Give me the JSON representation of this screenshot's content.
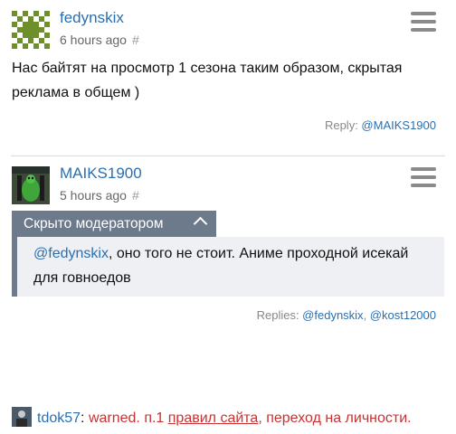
{
  "comments": [
    {
      "author": "fedynskix",
      "time": "6 hours ago",
      "hash": "#",
      "text": "Нас байтят на просмотр 1 сезона таким образом, скрытая реклама в общем )",
      "reply_prefix": "Reply: ",
      "reply_user": "@MAIKS1900"
    },
    {
      "author": "MAIKS1900",
      "time": "5 hours ago",
      "hash": "#",
      "hidden_label": "Скрыто модератором",
      "text_mention": "@fedynskix",
      "text_rest": ", оно того не стоит. Аниме проходной исекай для говноедов",
      "replies_prefix": "Replies: ",
      "replies_user1": "@fedynskix",
      "replies_sep": ", ",
      "replies_user2": "@kost12000"
    }
  ],
  "warning": {
    "user": "tdok57",
    "colon": ":",
    "prefix": " warned. п.1 ",
    "rules_link": "правил сайта",
    "suffix": ", переход на личности."
  },
  "colors": {
    "link": "#2a6fb0",
    "moderator_bar": "#6c7a8b",
    "hidden_bg": "#eef0f4",
    "warning_red": "#c83232"
  },
  "icons": {
    "menu": "hamburger-menu-icon",
    "collapse": "chevron-up-icon"
  }
}
